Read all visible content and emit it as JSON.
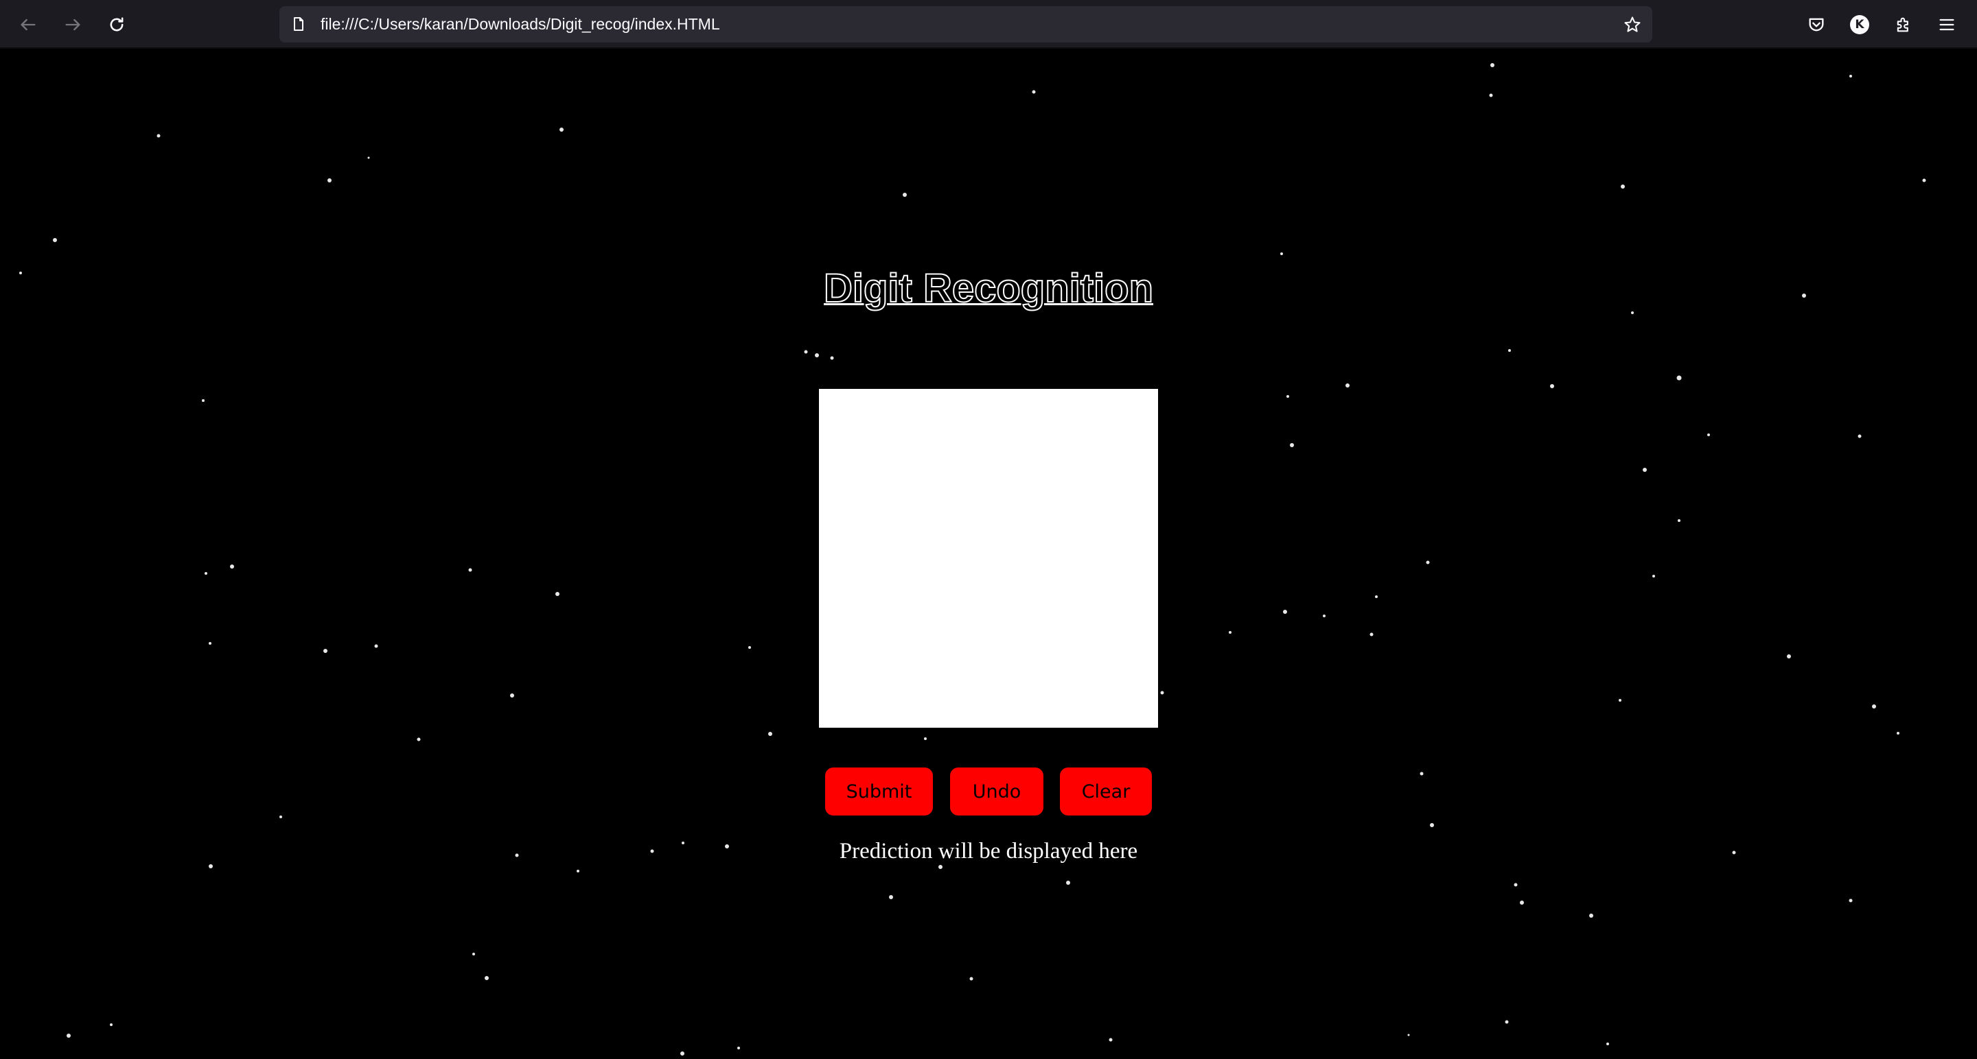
{
  "browser": {
    "url": "file:///C:/Users/karan/Downloads/Digit_recog/index.HTML",
    "account_initial": "K",
    "icons": {
      "back": "arrow-left-icon",
      "forward": "arrow-right-icon",
      "reload": "reload-icon",
      "page": "document-icon",
      "bookmark": "star-icon",
      "pocket": "pocket-icon",
      "extensions": "puzzle-icon",
      "menu": "hamburger-menu-icon"
    }
  },
  "page": {
    "title": "Digit Recognition",
    "buttons": {
      "submit": "Submit",
      "undo": "Undo",
      "clear": "Clear"
    },
    "prediction_text": "Prediction will be displayed here",
    "colors": {
      "background": "#000000",
      "button": "#ff0000",
      "canvas": "#ffffff",
      "chrome": "#1c1b22",
      "urlbar": "#2b2a33"
    }
  }
}
